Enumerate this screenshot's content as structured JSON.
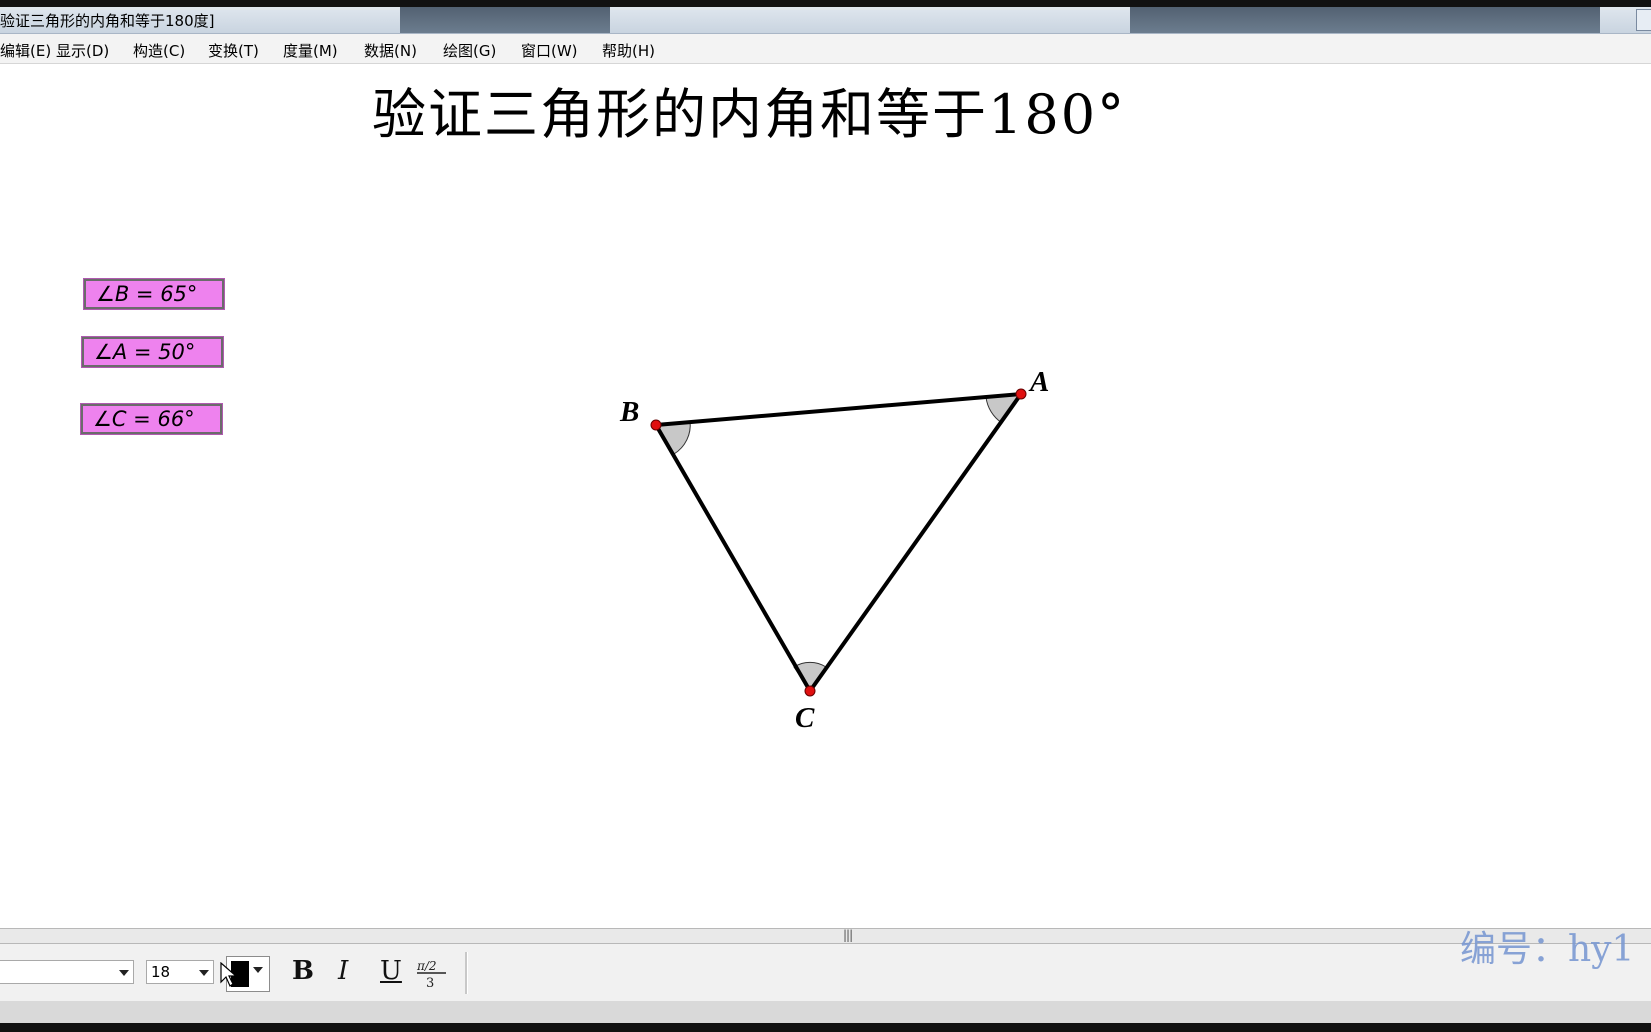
{
  "window": {
    "title": "验证三角形的内角和等于180度]"
  },
  "menu": {
    "items": [
      "编辑(E)",
      "显示(D)",
      "构造(C)",
      "变换(T)",
      "度量(M)",
      "数据(N)",
      "绘图(G)",
      "窗口(W)",
      "帮助(H)"
    ]
  },
  "sketch": {
    "heading": "验证三角形的内角和等于180°",
    "measurements": [
      {
        "angle": "∠B",
        "eq": " = ",
        "value": "65°"
      },
      {
        "angle": "∠A",
        "eq": " = ",
        "value": "50°"
      },
      {
        "angle": "∠C",
        "eq": " = ",
        "value": "66°"
      }
    ],
    "vertices": {
      "A": {
        "label": "A"
      },
      "B": {
        "label": "B"
      },
      "C": {
        "label": "C"
      }
    }
  },
  "text_toolbar": {
    "font_name": "",
    "font_size": "18",
    "bold_label": "B",
    "italic_label": "I",
    "underline_label": "U",
    "math_label": "π/2 / 3",
    "text_color": "#000000"
  },
  "watermark": "编号：hy1"
}
